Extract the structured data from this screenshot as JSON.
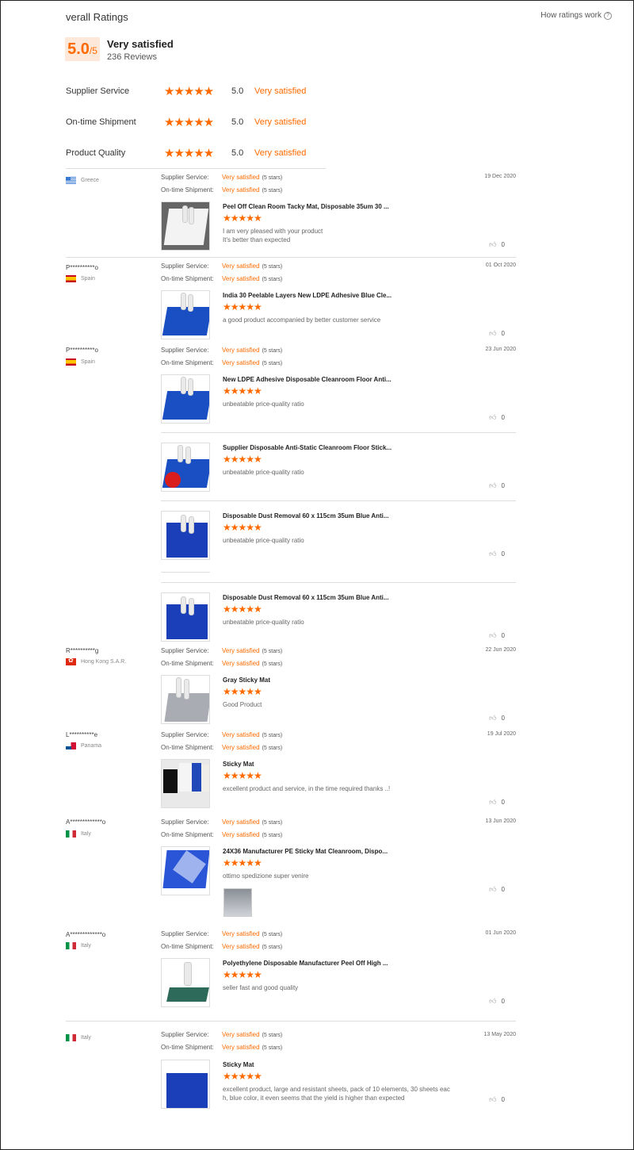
{
  "header": {
    "title": "verall Ratings",
    "how_link": "How ratings work",
    "score": "5.0",
    "score_out_of": "/5",
    "overall_label": "Very satisfied",
    "review_count": "236 Reviews"
  },
  "summary": [
    {
      "label": "Supplier Service",
      "stars": "★★★★★",
      "value": "5.0",
      "text": "Very satisfied"
    },
    {
      "label": "On-time Shipment",
      "stars": "★★★★★",
      "value": "5.0",
      "text": "Very satisfied"
    },
    {
      "label": "Product Quality",
      "stars": "★★★★★",
      "value": "5.0",
      "text": "Very satisfied"
    }
  ],
  "labels": {
    "supplier_service": "Supplier Service:",
    "ontime_shipment": "On-time Shipment:",
    "very_satisfied": "Very satisfied",
    "five_stars": "(5 stars)",
    "stars": "★★★★★",
    "like_icon": "thumb-up-icon"
  },
  "reviews": [
    {
      "name": "",
      "country": "Greece",
      "date": "19 Dec 2020",
      "products": [
        {
          "name": "Peel Off Clean Room Tacky Mat, Disposable 35um 30 ...",
          "lines": [
            "I am very pleased with your product",
            "It's better than expected"
          ],
          "likes": "0"
        }
      ]
    },
    {
      "name": "P**********o",
      "country": "Spain",
      "date": "01 Oct 2020",
      "products": [
        {
          "name": "India 30 Peelable Layers New LDPE Adhesive Blue Cle...",
          "lines": [
            "a good product accompanied by better customer service"
          ],
          "likes": "0"
        }
      ]
    },
    {
      "name": "P**********o",
      "country": "Spain",
      "date": "23 Jun 2020",
      "products": [
        {
          "name": "New LDPE Adhesive Disposable Cleanroom Floor Anti...",
          "lines": [
            "unbeatable price-quality ratio"
          ],
          "likes": "0"
        },
        {
          "name": "Supplier Disposable Anti-Static Cleanroom Floor Stick...",
          "lines": [
            "unbeatable price-quality ratio"
          ],
          "likes": "0"
        },
        {
          "name": "Disposable Dust Removal 60 x 115cm 35um Blue Anti...",
          "lines": [
            "unbeatable price-quality ratio"
          ],
          "likes": "0"
        },
        {
          "name": "Disposable Dust Removal 60 x 115cm 35um Blue Anti...",
          "lines": [
            "unbeatable price-quality ratio"
          ],
          "likes": "0"
        }
      ]
    },
    {
      "name": "R**********g",
      "country": "Hong Kong S.A.R.",
      "date": "22 Jun 2020",
      "products": [
        {
          "name": "Gray Sticky Mat",
          "lines": [
            "Good Product"
          ],
          "likes": "0"
        }
      ]
    },
    {
      "name": "L**********e",
      "country": "Panama",
      "date": "19 Jul 2020",
      "products": [
        {
          "name": "Sticky Mat",
          "lines": [
            "excellent product and service, in the time required thanks ..!"
          ],
          "likes": "0"
        }
      ]
    },
    {
      "name": "A*************o",
      "country": "Italy",
      "date": "13 Jun 2020",
      "products": [
        {
          "name": "24X36 Manufacturer PE Sticky Mat Cleanroom, Dispo...",
          "lines": [
            "ottimo spedizione super venire"
          ],
          "likes": "0"
        }
      ]
    },
    {
      "name": "A*************o",
      "country": "Italy",
      "date": "01 Jun 2020",
      "products": [
        {
          "name": "Polyethylene Disposable Manufacturer Peel Off High ...",
          "lines": [
            "seller fast and good quality"
          ],
          "likes": "0"
        }
      ]
    },
    {
      "name": "",
      "country": "Italy",
      "date": "13 May 2020",
      "products": [
        {
          "name": "Sticky Mat",
          "lines": [
            "excellent product, large and resistant sheets, pack of 10 elements, 30 sheets eac",
            "h, blue color, it even seems that the yield is higher than expected"
          ],
          "likes": "0"
        }
      ]
    }
  ],
  "colors": {
    "accent": "#ff6a00",
    "score_bg": "#fde8d9"
  }
}
